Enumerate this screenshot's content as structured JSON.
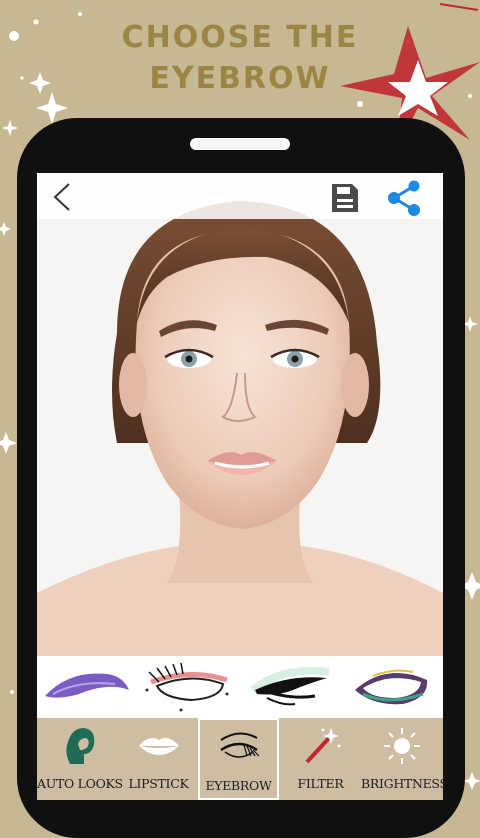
{
  "headline": {
    "line1": "CHOOSE THE",
    "line2": "EYEBROW"
  },
  "colors": {
    "background": "#c7b894",
    "headline": "#9b8545",
    "toolbar": "#cdbda2",
    "share_accent": "#1e88e5",
    "star_accent": "#c0282d"
  },
  "topbar": {
    "back_icon": "chevron-left-icon",
    "save_icon": "floppy-disk-icon",
    "share_icon": "share-icon"
  },
  "eyebrow_styles": [
    "purple-glitter-liner",
    "lashes-pink-liner",
    "green-wing-liner",
    "purple-green-smoky"
  ],
  "toolbar": {
    "selected": "EYEBROW",
    "items": [
      {
        "label": "AUTO LOOKS",
        "icon": "face-profile-icon"
      },
      {
        "label": "LIPSTICK",
        "icon": "lips-icon"
      },
      {
        "label": "EYEBROW",
        "icon": "eye-lashes-icon"
      },
      {
        "label": "FILTER",
        "icon": "magic-wand-icon"
      },
      {
        "label": "BRIGHTNESS",
        "icon": "sun-icon"
      }
    ]
  }
}
